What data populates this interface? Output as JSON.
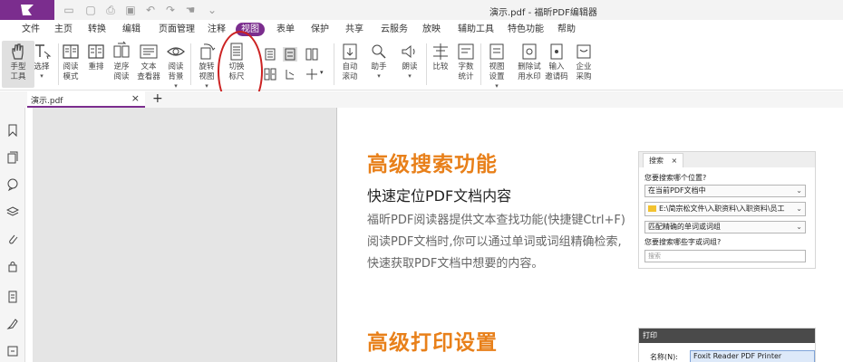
{
  "window": {
    "title": "演示.pdf - 福昕PDF编辑器"
  },
  "menu": {
    "items": [
      {
        "label": "文件"
      },
      {
        "label": "主页"
      },
      {
        "label": "转换"
      },
      {
        "label": "编辑"
      },
      {
        "label": "页面管理"
      },
      {
        "label": "注释"
      },
      {
        "label": "视图"
      },
      {
        "label": "表单"
      },
      {
        "label": "保护"
      },
      {
        "label": "共享"
      },
      {
        "label": "云服务"
      },
      {
        "label": "放映"
      },
      {
        "label": "辅助工具"
      },
      {
        "label": "特色功能"
      },
      {
        "label": "帮助"
      }
    ],
    "active": "视图"
  },
  "ribbon": {
    "hand": "手型\n工具",
    "select": "选择",
    "reading_mode": "阅读\n模式",
    "reflow": "重排",
    "reverse_read": "逆序\n阅读",
    "text_viewer": "文本\n查看器",
    "read_bg": "阅读\n背景",
    "rotate": "旋转\n视图",
    "toggle_ruler": "切换\n标尺",
    "auto_scroll": "自动\n滚动",
    "assistant": "助手",
    "read_aloud": "朗读",
    "compare": "比较",
    "word_count": "字数\n统计",
    "view_settings": "视图\n设置",
    "delete_watermark": "删除试\n用水印",
    "invite_code": "输入\n邀请码",
    "enterprise": "企业\n采购"
  },
  "tabs": {
    "doc": "演示.pdf",
    "close": "×",
    "new": "+"
  },
  "page": {
    "section1": {
      "title": "高级搜索功能",
      "subtitle": "快速定位PDF文档内容",
      "lines": [
        "福昕PDF阅读器提供文本查找功能(快捷键Ctrl+F)",
        "阅读PDF文档时,你可以通过单词或词组精确检索,",
        "快速获取PDF文档中想要的内容。"
      ]
    },
    "search_panel": {
      "tab": "搜索",
      "close": "×",
      "q_where": "您要搜索哪个位置?",
      "opt_where": "在当前PDF文档中",
      "path": "E:\\简宗松文件\\入职资料\\入职资料\\员工",
      "opt_match": "匹配精确的单词或词组",
      "q_what": "您要搜索哪些字或词组?",
      "input_placeholder": "搜索"
    },
    "section2": {
      "title": "高级打印设置"
    },
    "print_panel": {
      "title": "打印",
      "name_label": "名称(N):",
      "printer": "Foxit Reader PDF Printer"
    }
  },
  "colors": {
    "brand": "#7b2d8e",
    "accent_orange": "#e8801a",
    "annotation_red": "#cc2222"
  },
  "icons": [
    "logo-icon",
    "open-folder-icon",
    "new-doc-icon",
    "print-icon",
    "save-icon",
    "undo-icon",
    "redo-icon",
    "hand-icon",
    "dropdown-icon"
  ]
}
